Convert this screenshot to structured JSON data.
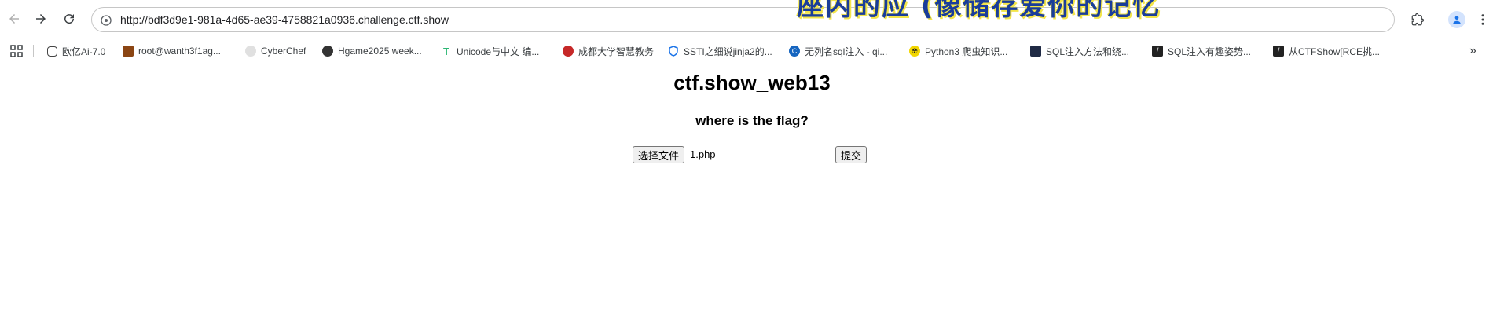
{
  "browser": {
    "url": "http://bdf3d9e1-981a-4d65-ae39-4758821a0936.challenge.ctf.show",
    "overlay_text": "座内的应 (像储存爱你的记忆"
  },
  "bookmarks": [
    {
      "label": "欧亿Ai-7.0",
      "icon": "chat-icon",
      "color": "#444444"
    },
    {
      "label": "root@wanth3f1ag...",
      "icon": "avatar-icon",
      "color": "#8b4513"
    },
    {
      "label": "CyberChef",
      "icon": "chef-hat-icon",
      "color": "#9e9e9e"
    },
    {
      "label": "Hgame2025 week...",
      "icon": "person-icon",
      "color": "#333333"
    },
    {
      "label": "Unicode与中文 编...",
      "icon": "t-icon",
      "color": "#2bb673"
    },
    {
      "label": "成都大学智慧教务",
      "icon": "school-icon",
      "color": "#c62828"
    },
    {
      "label": "SSTI之细说jinja2的...",
      "icon": "shield-icon",
      "color": "#1a73e8"
    },
    {
      "label": "无列名sql注入 - qi...",
      "icon": "circle-c-icon",
      "color": "#1565c0"
    },
    {
      "label": "Python3 爬虫知识...",
      "icon": "hazard-icon",
      "color": "#e6b800"
    },
    {
      "label": "SQL注入方法和绕...",
      "icon": "dark-square-icon",
      "color": "#1f2a44"
    },
    {
      "label": "SQL注入有趣姿势...",
      "icon": "slash-icon",
      "color": "#222222"
    },
    {
      "label": "从CTFShow[RCE挑...",
      "icon": "slash-icon",
      "color": "#222222"
    }
  ],
  "page": {
    "title": "ctf.show_web13",
    "subtitle": "where is the flag?",
    "file_button": "选择文件",
    "file_name": "1.php",
    "submit_button": "提交"
  }
}
